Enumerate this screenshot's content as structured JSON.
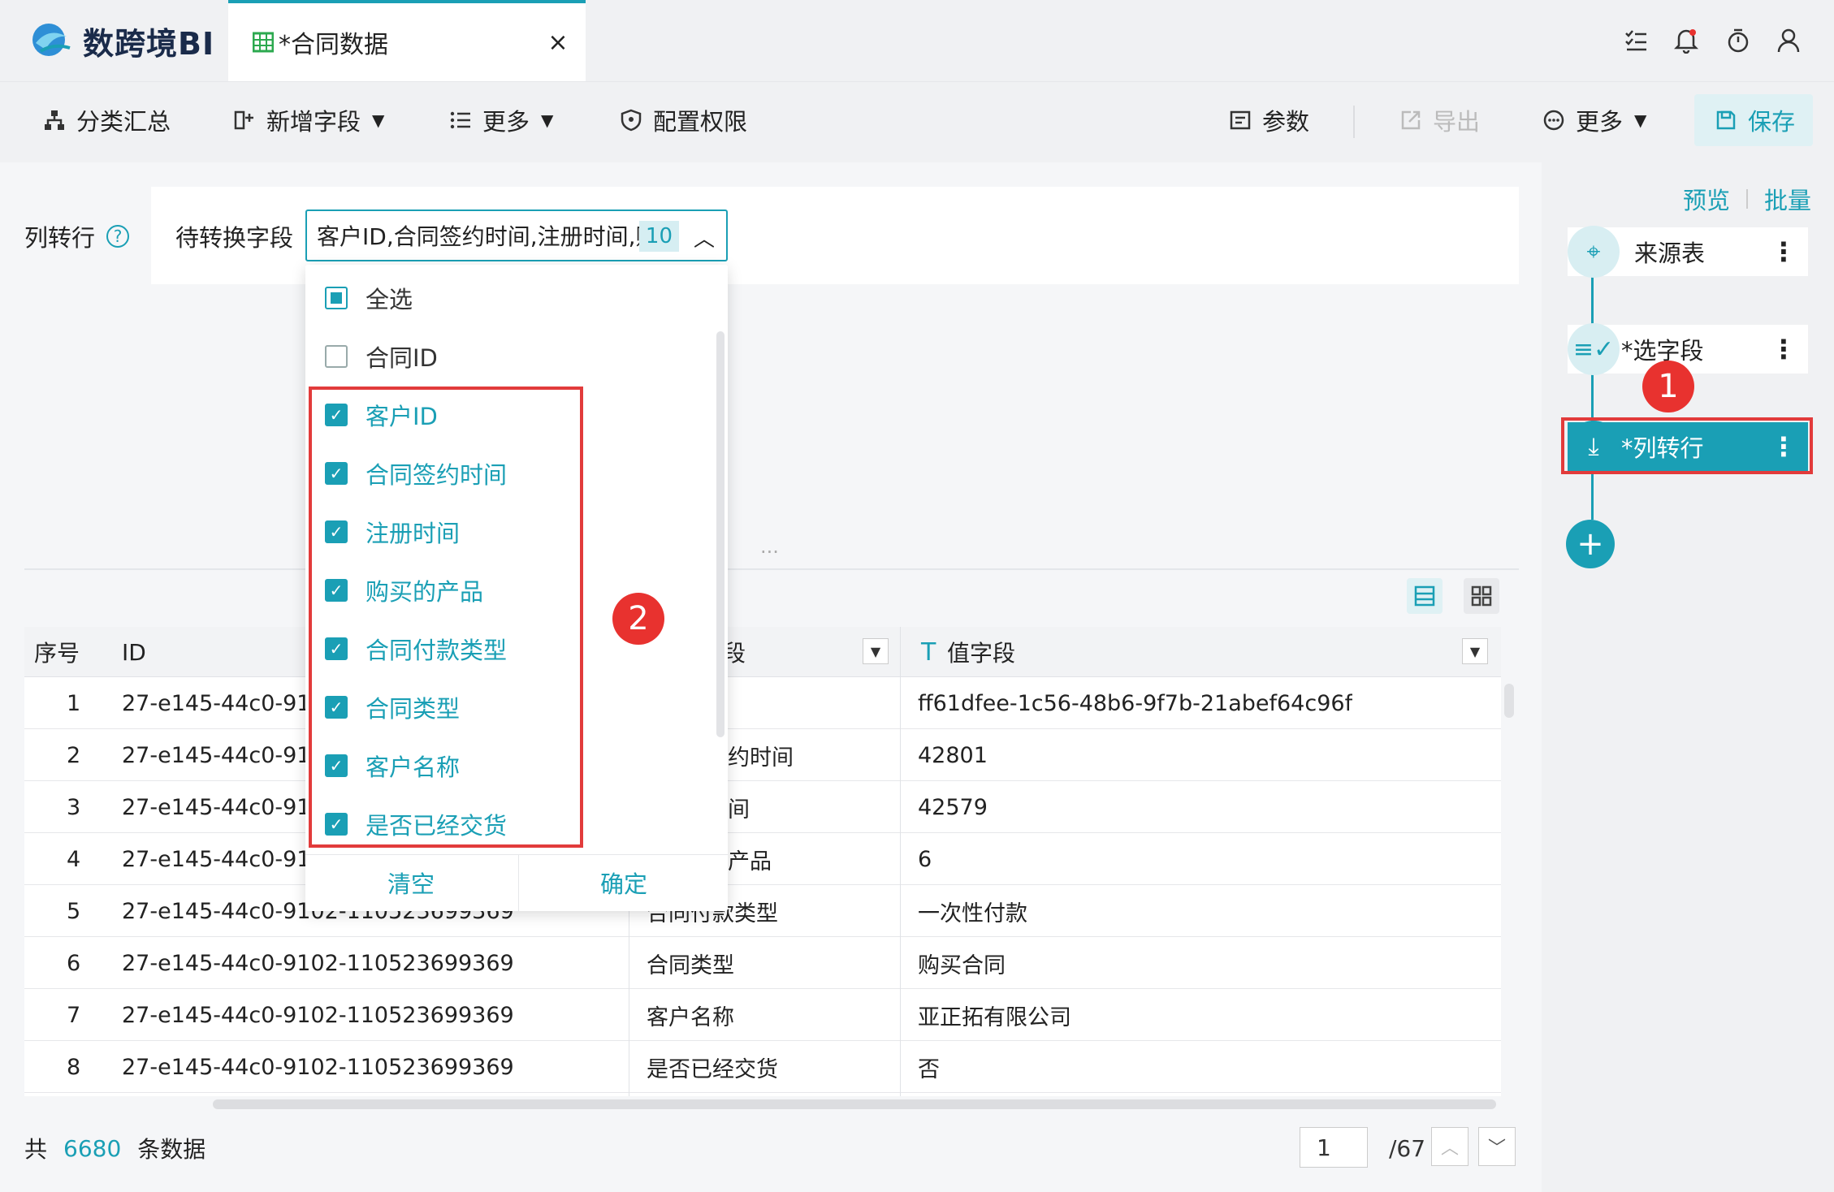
{
  "app": {
    "logo_text": "数跨境BI",
    "tab_title": "*合同数据",
    "tab_close": "×"
  },
  "toolbar": {
    "group_summary": "分类汇总",
    "add_field": "新增字段",
    "more1": "更多",
    "config_perm": "配置权限",
    "params": "参数",
    "export": "导出",
    "more2": "更多",
    "save": "保存"
  },
  "config": {
    "title": "列转行",
    "field_label": "待转换字段",
    "selected_text": "客户ID,合同签约时间,注册时间,购",
    "selected_count": "10"
  },
  "dropdown": {
    "select_all": "全选",
    "options": [
      {
        "label": "合同ID",
        "checked": false
      },
      {
        "label": "客户ID",
        "checked": true
      },
      {
        "label": "合同签约时间",
        "checked": true
      },
      {
        "label": "注册时间",
        "checked": true
      },
      {
        "label": "购买的产品",
        "checked": true
      },
      {
        "label": "合同付款类型",
        "checked": true
      },
      {
        "label": "合同类型",
        "checked": true
      },
      {
        "label": "客户名称",
        "checked": true
      },
      {
        "label": "是否已经交货",
        "checked": true
      }
    ],
    "clear": "清空",
    "confirm": "确定"
  },
  "annotations": {
    "badge1": "1",
    "badge2": "2"
  },
  "table": {
    "headers": {
      "index": "序号",
      "id": "ID",
      "name_field": "段",
      "value_field": "值字段"
    },
    "rows": [
      {
        "index": "1",
        "id": "27-e145-44c0-910",
        "name": "",
        "value": "ff61dfee-1c56-48b6-9f7b-21abef64c96f"
      },
      {
        "index": "2",
        "id": "27-e145-44c0-910",
        "name": "约时间",
        "value": "42801"
      },
      {
        "index": "3",
        "id": "27-e145-44c0-910",
        "name": "间",
        "value": "42579"
      },
      {
        "index": "4",
        "id": "27-e145-44c0-910",
        "name": "产品",
        "value": "6"
      },
      {
        "index": "5",
        "id": "27-e145-44c0-9102-110523699369",
        "name": "合同付款类型",
        "value": "一次性付款"
      },
      {
        "index": "6",
        "id": "27-e145-44c0-9102-110523699369",
        "name": "合同类型",
        "value": "购买合同"
      },
      {
        "index": "7",
        "id": "27-e145-44c0-9102-110523699369",
        "name": "客户名称",
        "value": "亚正拓有限公司"
      },
      {
        "index": "8",
        "id": "27-e145-44c0-9102-110523699369",
        "name": "是否已经交货",
        "value": "否"
      }
    ]
  },
  "footer": {
    "prefix": "共",
    "count": "6680",
    "suffix": "条数据",
    "page": "1",
    "total_pages": "/67"
  },
  "right_panel": {
    "preview": "预览",
    "batch": "批量",
    "nodes": [
      {
        "label": "来源表",
        "active": false
      },
      {
        "label": "*选字段",
        "active": false
      },
      {
        "label": "*列转行",
        "active": true
      }
    ]
  },
  "colors": {
    "accent": "#1a9fb5",
    "highlight": "#e23b3b"
  }
}
